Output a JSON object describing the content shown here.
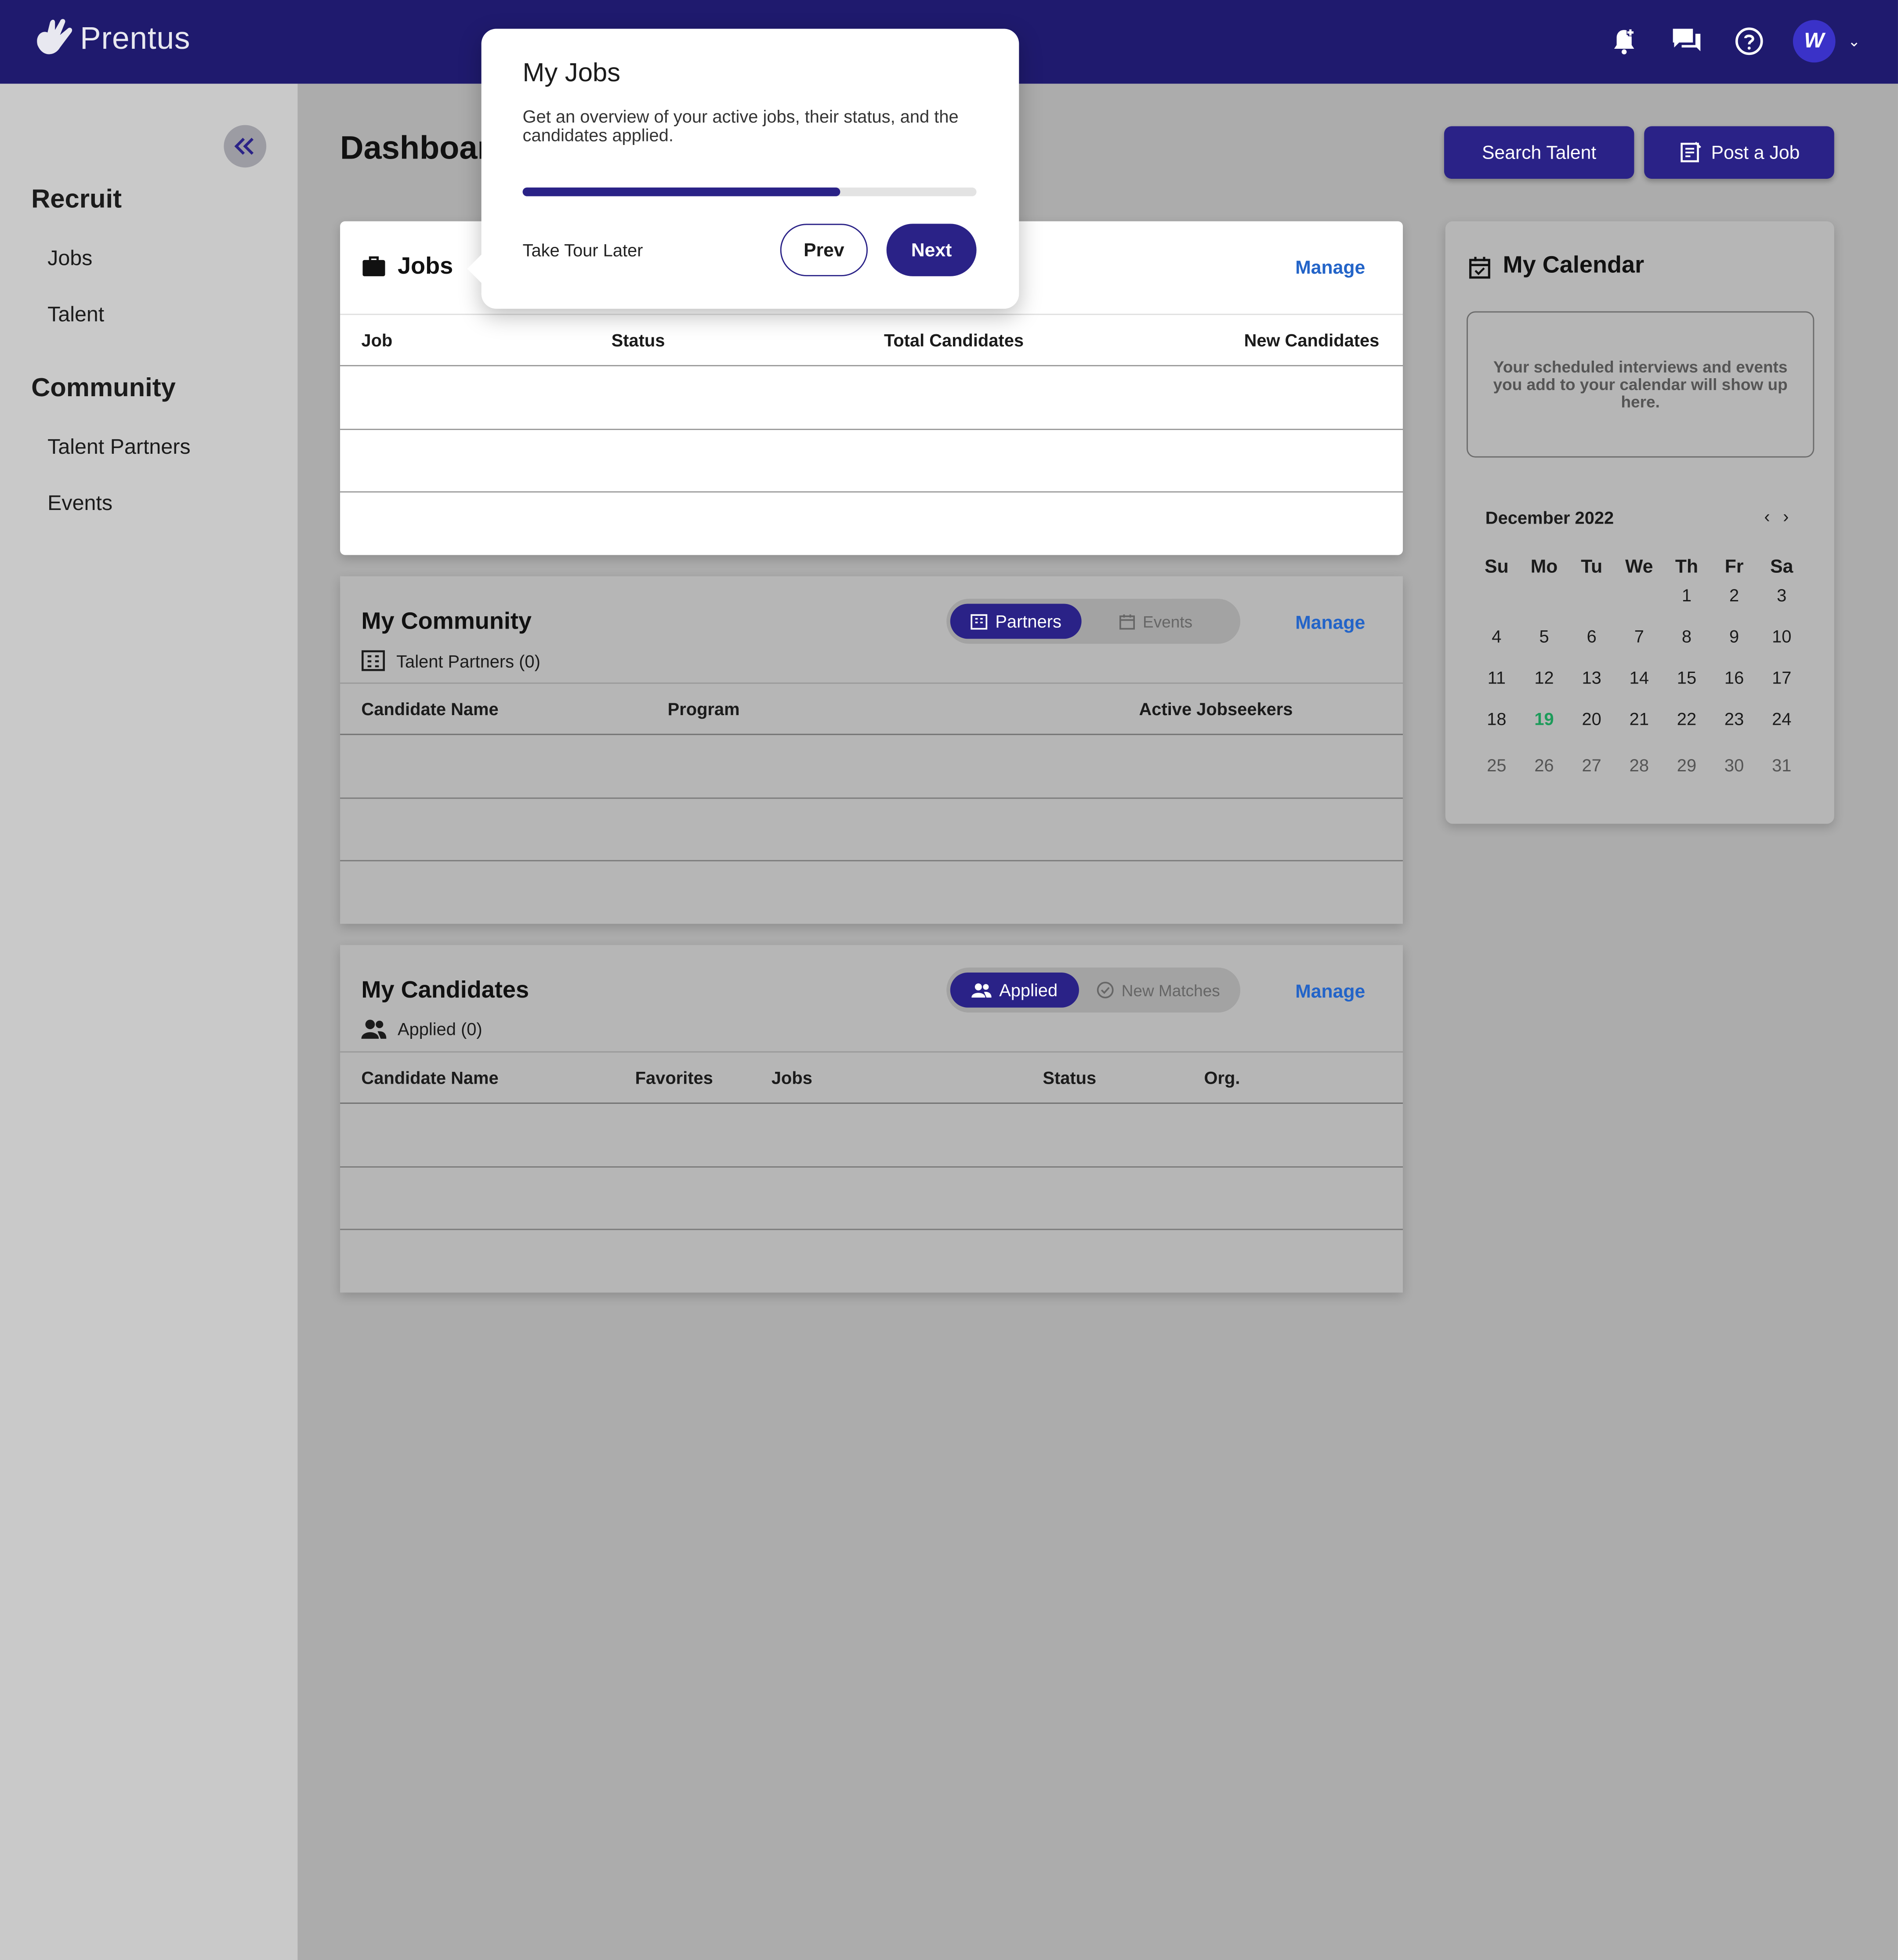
{
  "app": {
    "name": "Prentus"
  },
  "colors": {
    "primary": "#2a2287",
    "topbar": "#1f1a6e",
    "link": "#2364c8",
    "today": "#1d9b5a"
  },
  "topbar": {
    "icons": [
      "bell-plus-icon",
      "chat-icon",
      "help-icon"
    ],
    "avatar_letter": "W"
  },
  "sidebar": {
    "sections": [
      {
        "title": "Recruit",
        "items": [
          "Jobs",
          "Talent"
        ]
      },
      {
        "title": "Community",
        "items": [
          "Talent Partners",
          "Events"
        ]
      }
    ]
  },
  "page": {
    "title": "Dashboard",
    "search_talent": "Search Talent",
    "post_job": "Post a Job"
  },
  "jobs_card": {
    "title": "Jobs",
    "manage": "Manage",
    "columns": [
      "Job",
      "Status",
      "Total Candidates",
      "New Candidates"
    ]
  },
  "community_card": {
    "title": "My Community",
    "manage": "Manage",
    "toggle": {
      "active": "Partners",
      "inactive": "Events"
    },
    "subtitle": "Talent Partners (0)",
    "columns": [
      "Candidate Name",
      "Program",
      "Active Jobseekers"
    ]
  },
  "candidates_card": {
    "title": "My Candidates",
    "manage": "Manage",
    "toggle": {
      "active": "Applied",
      "inactive": "New Matches"
    },
    "subtitle": "Applied (0)",
    "columns": [
      "Candidate Name",
      "Favorites",
      "Jobs",
      "Status",
      "Org."
    ]
  },
  "calendar": {
    "title": "My Calendar",
    "empty_note": "Your scheduled interviews and events you add to your calendar will show up here.",
    "month": "December 2022",
    "weekdays": [
      "Su",
      "Mo",
      "Tu",
      "We",
      "Th",
      "Fr",
      "Sa"
    ],
    "weeks": [
      [
        "",
        "",
        "",
        "",
        "1",
        "2",
        "3"
      ],
      [
        "4",
        "5",
        "6",
        "7",
        "8",
        "9",
        "10"
      ],
      [
        "11",
        "12",
        "13",
        "14",
        "15",
        "16",
        "17"
      ],
      [
        "18",
        "19",
        "20",
        "21",
        "22",
        "23",
        "24"
      ],
      [
        "25",
        "26",
        "27",
        "28",
        "29",
        "30",
        "31"
      ]
    ],
    "today": "19"
  },
  "tour": {
    "title": "My Jobs",
    "description": "Get an overview of your active jobs, their status, and the candidates applied.",
    "progress": 0.7,
    "later": "Take Tour Later",
    "prev": "Prev",
    "next": "Next"
  }
}
